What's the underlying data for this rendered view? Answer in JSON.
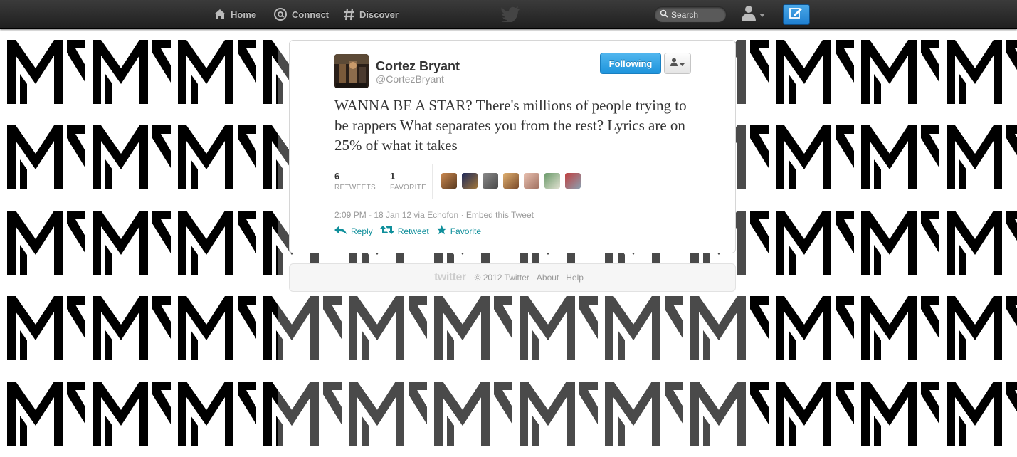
{
  "topbar": {
    "nav": [
      {
        "label": "Home",
        "icon": "home-icon"
      },
      {
        "label": "Connect",
        "icon": "at-icon"
      },
      {
        "label": "Discover",
        "icon": "hash-icon"
      }
    ],
    "search_placeholder": "Search"
  },
  "tweet": {
    "author_name": "Cortez Bryant",
    "author_handle": "@CortezBryant",
    "follow_label": "Following",
    "text": "WANNA BE A STAR? There's millions of people trying to be rappers What separates you from the rest? Lyrics are on 25% of what it takes",
    "retweets_count": "6",
    "retweets_label": "RETWEETS",
    "favorites_count": "1",
    "favorites_label": "FAVORITE",
    "timestamp": "2:09 PM - 18 Jan 12",
    "via": "via Echofon",
    "separator": "·",
    "embed_label": "Embed this Tweet",
    "actions": {
      "reply": "Reply",
      "retweet": "Retweet",
      "favorite": "Favorite"
    }
  },
  "footer": {
    "logo": "twitter",
    "copyright": "© 2012 Twitter",
    "about": "About",
    "help": "Help"
  },
  "colors": {
    "accent": "#1e94dc",
    "action_link": "#0f8f9b",
    "topbar": "#2b2b2b"
  }
}
